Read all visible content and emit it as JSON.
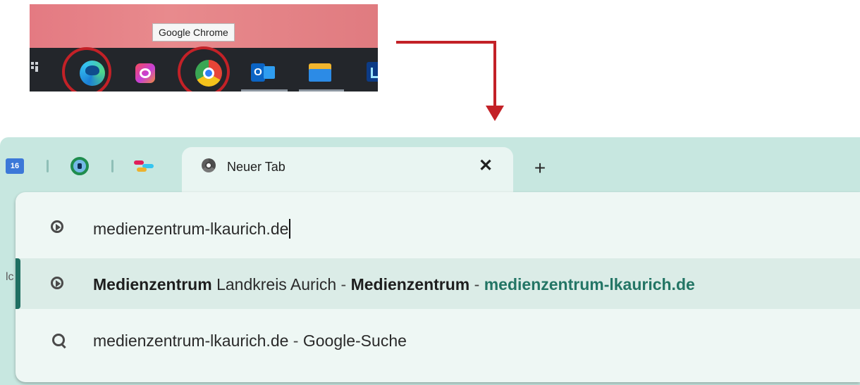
{
  "taskbar": {
    "tooltip": "Google Chrome",
    "icons": [
      "task-view-icon",
      "edge-icon",
      "creative-cloud-icon",
      "chrome-icon",
      "outlook-icon",
      "file-explorer-icon",
      "partial-app-icon"
    ],
    "outlook_letter": "O",
    "highlight_color": "#c32127"
  },
  "browser": {
    "pinned_tabs": [
      "calendar-icon",
      "green-ring-icon",
      "slack-icon"
    ],
    "calendar_day": "16",
    "active_tab": {
      "title": "Neuer Tab",
      "close_label": "✕"
    },
    "new_tab_label": "+",
    "side_char": "lc",
    "omnibox": {
      "input": "medienzentrum-lkaurich.de",
      "suggestions": [
        {
          "parts": [
            "Medienzentrum",
            " Landkreis Aurich",
            " - ",
            "Medienzentrum",
            " - ",
            "medienzentrum-lkaurich.de"
          ]
        },
        {
          "query": "medienzentrum-lkaurich.de",
          "separator": " - ",
          "engine": "Google-Suche"
        }
      ]
    },
    "accent_color": "#1f6f62",
    "tabstrip_color": "#c7e7e0"
  }
}
